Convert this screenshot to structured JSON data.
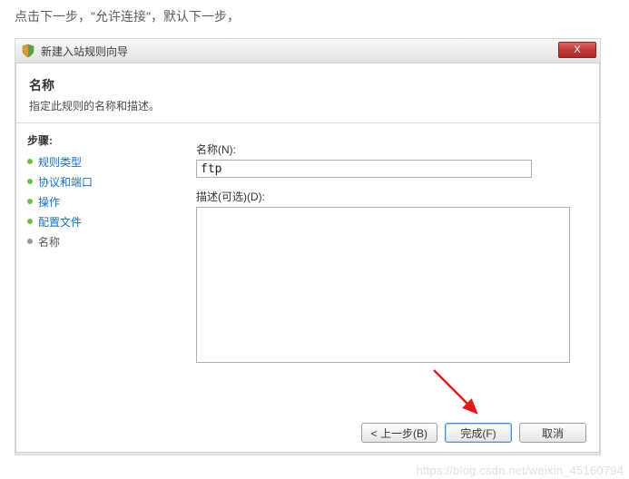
{
  "instruction": "点击下一步，\"允许连接\"，默认下一步，",
  "window": {
    "title": "新建入站规则向导",
    "close_label": "X"
  },
  "header": {
    "title": "名称",
    "subtitle": "指定此规则的名称和描述。"
  },
  "sidebar": {
    "heading": "步骤:",
    "steps": [
      {
        "label": "规则类型",
        "type": "link"
      },
      {
        "label": "协议和端口",
        "type": "link"
      },
      {
        "label": "操作",
        "type": "link"
      },
      {
        "label": "配置文件",
        "type": "link"
      },
      {
        "label": "名称",
        "type": "current"
      }
    ]
  },
  "form": {
    "name_label": "名称(N):",
    "name_value": "ftp",
    "desc_label": "描述(可选)(D):",
    "desc_value": ""
  },
  "buttons": {
    "back": "< 上一步(B)",
    "finish": "完成(F)",
    "cancel": "取消"
  },
  "watermark": "https://blog.csdn.net/weixin_45160794"
}
